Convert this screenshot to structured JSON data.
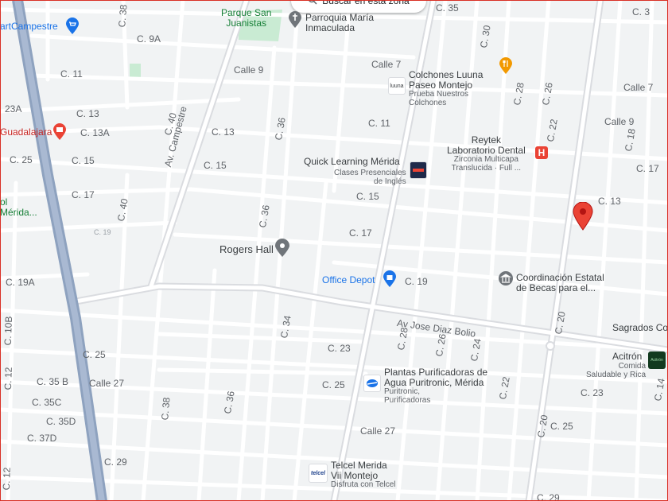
{
  "map": {
    "search_area_button": "Buscar en esta zona",
    "streets": {
      "c35": "C. 35",
      "c3": "C. 3",
      "c9a": "C. 9A",
      "calle7_top": "Calle 7",
      "c11_left": "C. 11",
      "c38_top": "C. 38",
      "calle9": "Calle 9",
      "c30": "C. 30",
      "c28_top": "C. 28",
      "c26_top": "C. 26",
      "calle7_right": "Calle 7",
      "c13_left": "C. 13",
      "c23a": "23A",
      "c13a": "C. 13A",
      "c40_top": "C. 40",
      "c13_mid": "C. 13",
      "c36_top": "C. 36",
      "c11_mid": "C. 11",
      "c22_top": "C. 22",
      "calle9_right": "Calle 9",
      "c18_right": "C. 18",
      "c25_left": "C. 25",
      "c15_left": "C. 15",
      "c15_mid": "C. 15",
      "av_campestre": "Av. Campestre",
      "c17_right": "C. 17",
      "c17_left": "C. 17",
      "c15_center": "C. 15",
      "c13_right": "C. 13",
      "c40_mid": "C. 40",
      "c36_mid": "C. 36",
      "c19_faint": "C. 19",
      "c17_center": "C. 17",
      "c19a": "C. 19A",
      "c19_center": "C. 19",
      "av_jose_diaz_bolio": "Av Jose Diaz Bolio",
      "c10b": "C. 10B",
      "c34": "C. 34",
      "c28_mid": "C. 28",
      "c26_mid": "C. 26",
      "c24": "C. 24",
      "c20": "C. 20",
      "c25_mid": "C. 25",
      "c23_mid": "C. 23",
      "c35b": "C. 35 B",
      "calle27_left": "Calle 27",
      "c12_left": "C. 12",
      "c35c": "C. 35C",
      "c25_center": "C. 25",
      "c22_low": "C. 22",
      "c23_right": "C. 23",
      "c14_right": "C. 14",
      "c35d": "C. 35D",
      "c37d": "C. 37D",
      "c36_low": "C. 36",
      "c38_low": "C. 38",
      "calle27_mid": "Calle 27",
      "c20_low": "C. 20",
      "c25_right": "C. 25",
      "c29": "C. 29",
      "c12_bottom": "C. 12",
      "c29_right": "C. 29"
    },
    "places": {
      "walmart": "artCampestre",
      "parque": [
        "Parque San",
        "Juanistas"
      ],
      "parroquia": [
        "Parroquia María",
        "Inmaculada"
      ],
      "colchones": [
        "Colchones Luuna",
        "Paseo Montejo"
      ],
      "colchones_sub": [
        "Prueba Nuestros",
        "Colchones"
      ],
      "guadalajara": "Guadalajara",
      "reytek": [
        "Reytek",
        "Laboratorio Dental"
      ],
      "reytek_sub": [
        "Zirconia Multicapa",
        "Translucida · Full ..."
      ],
      "quick_learning": "Quick Learning Mérida",
      "quick_learning_sub": [
        "Clases Presenciales",
        "de Inglés"
      ],
      "merida_left": [
        "ol",
        "Mérida..."
      ],
      "rogers_hall": "Rogers Hall",
      "office_depot": "Office Depot",
      "becas": [
        "Coordinación Estatal",
        "de Becas para el..."
      ],
      "sagrados": "Sagrados Co",
      "acitron": "Acitrón",
      "acitron_sub": [
        "Comida",
        "Saludable y Rica"
      ],
      "acitron_logo": "Acitrón",
      "plantas": [
        "Plantas Purificadoras de",
        "Agua Puritronic, Mérida"
      ],
      "plantas_sub": [
        "Puritronic,",
        "Purificadoras"
      ],
      "telcel": [
        "Telcel Merida",
        "Vii Montejo"
      ],
      "telcel_sub": "Disfruta con Telcel",
      "telcel_logo": "telcel",
      "luuna_logo": "luuna"
    },
    "colors": {
      "background": "#f1f3f4",
      "road": "#ffffff",
      "major_road": "#dadce0",
      "highway": "#8ea2bf",
      "park": "#c9ebd3",
      "pin_red": "#ea4335",
      "poi_blue": "#1a73e8",
      "poi_gray": "#70757a",
      "poi_orange": "#f29900"
    },
    "icons": [
      "search-icon",
      "shopping-cart-icon",
      "place-of-worship-icon",
      "restaurant-icon",
      "hospital-icon",
      "location-pin-icon",
      "shopping-bag-icon",
      "red-location-pin-icon",
      "store-icon"
    ]
  }
}
